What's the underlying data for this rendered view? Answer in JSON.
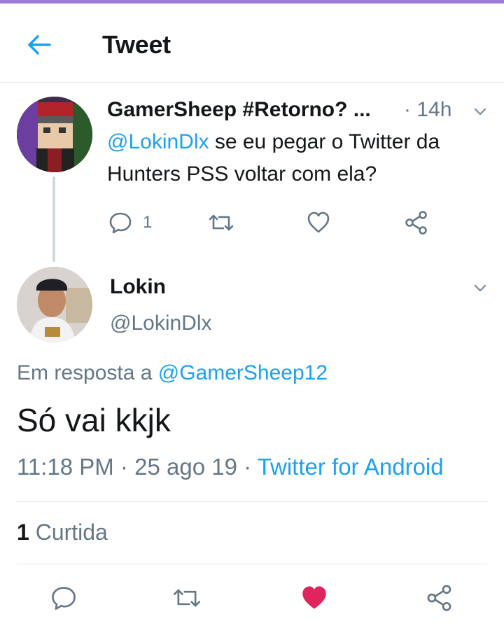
{
  "header": {
    "title": "Tweet",
    "back_icon": "arrow-left-icon"
  },
  "colors": {
    "accent": "#1da1f2",
    "like_active": "#e0245e",
    "muted": "#657786",
    "text": "#14171a",
    "top_bar": "#9b7ad6"
  },
  "parent_tweet": {
    "name": "GamerSheep #Retorno? ...",
    "time": "· 14h",
    "mention": "@LokinDlx",
    "text": " se eu pegar o Twitter da Hunters PSS voltar com ela?",
    "reply_count": "1"
  },
  "main_tweet": {
    "name": "Lokin",
    "handle": "@LokinDlx",
    "reply_to_label": "Em resposta a ",
    "reply_to_handle": "@GamerSheep12",
    "text": "Só vai kkjk",
    "time": "11:18 PM · 25 ago 19 · ",
    "source": "Twitter for Android",
    "likes_count": "1",
    "likes_label": " Curtida",
    "liked": true
  }
}
